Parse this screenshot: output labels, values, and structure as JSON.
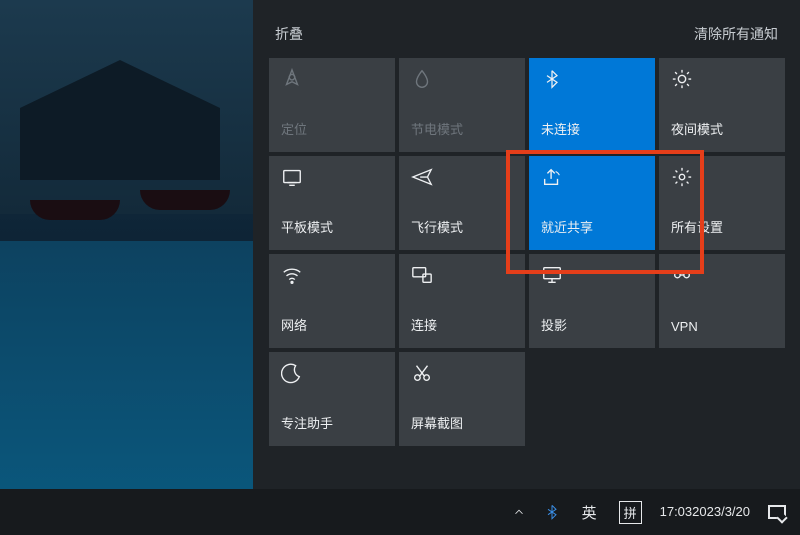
{
  "header": {
    "collapse": "折叠",
    "clear": "清除所有通知"
  },
  "tiles": [
    {
      "name": "location",
      "label": "定位",
      "icon": "location-icon",
      "state": "disabled"
    },
    {
      "name": "battery-saver",
      "label": "节电模式",
      "icon": "battery-icon",
      "state": "disabled"
    },
    {
      "name": "bluetooth",
      "label": "未连接",
      "icon": "bluetooth-icon",
      "state": "active"
    },
    {
      "name": "night-light",
      "label": "夜间模式",
      "icon": "sun-icon",
      "state": ""
    },
    {
      "name": "tablet-mode",
      "label": "平板模式",
      "icon": "tablet-icon",
      "state": ""
    },
    {
      "name": "airplane-mode",
      "label": "飞行模式",
      "icon": "airplane-icon",
      "state": ""
    },
    {
      "name": "nearby-share",
      "label": "就近共享",
      "icon": "share-icon",
      "state": "active"
    },
    {
      "name": "all-settings",
      "label": "所有设置",
      "icon": "gear-icon",
      "state": ""
    },
    {
      "name": "network",
      "label": "网络",
      "icon": "wifi-icon",
      "state": ""
    },
    {
      "name": "connect",
      "label": "连接",
      "icon": "connect-icon",
      "state": ""
    },
    {
      "name": "project",
      "label": "投影",
      "icon": "project-icon",
      "state": ""
    },
    {
      "name": "vpn",
      "label": "VPN",
      "icon": "vpn-icon",
      "state": ""
    },
    {
      "name": "focus-assist",
      "label": "专注助手",
      "icon": "moon-icon",
      "state": ""
    },
    {
      "name": "screen-snip",
      "label": "屏幕截图",
      "icon": "snip-icon",
      "state": ""
    }
  ],
  "taskbar": {
    "ime1": "英",
    "ime2": "拼",
    "time": "17:03",
    "date": "2023/3/20"
  },
  "colors": {
    "active": "#0078d7",
    "highlight": "#e53e1a"
  }
}
